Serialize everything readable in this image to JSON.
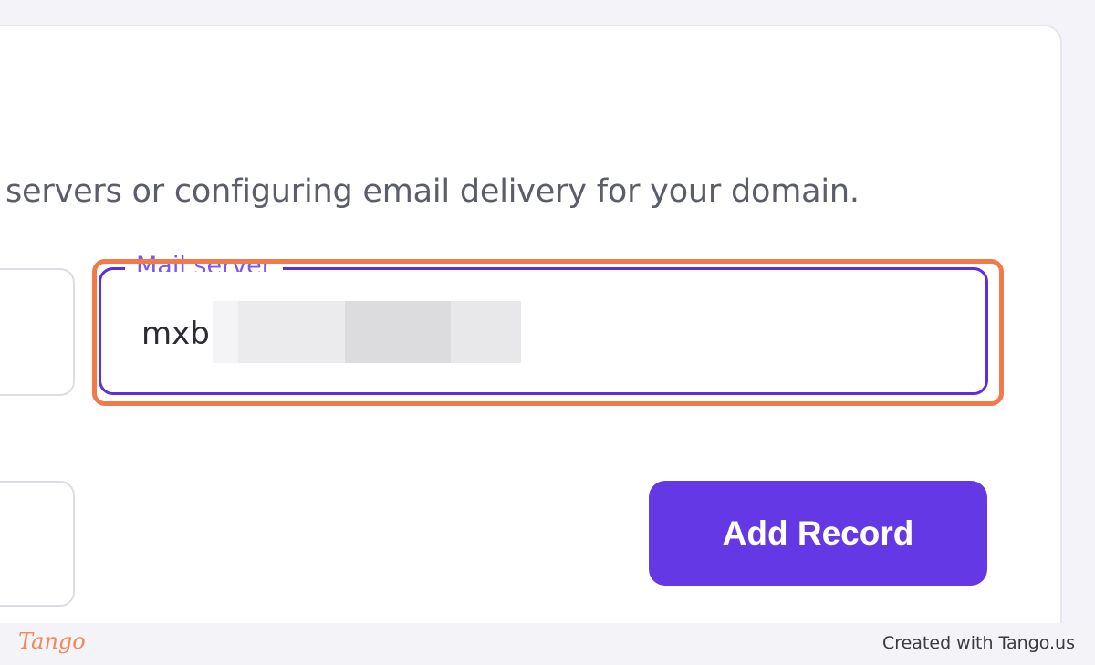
{
  "description": "servers or configuring email delivery for your domain.",
  "mail_server": {
    "label": "Mail server",
    "value": "mxb"
  },
  "buttons": {
    "add_record": "Add Record"
  },
  "footer": {
    "logo": "Tango",
    "created_with": "Created with Tango.us"
  },
  "colors": {
    "accent": "#6439e5",
    "focus_border": "#5b2ee0",
    "highlight": "#f27a4a"
  }
}
